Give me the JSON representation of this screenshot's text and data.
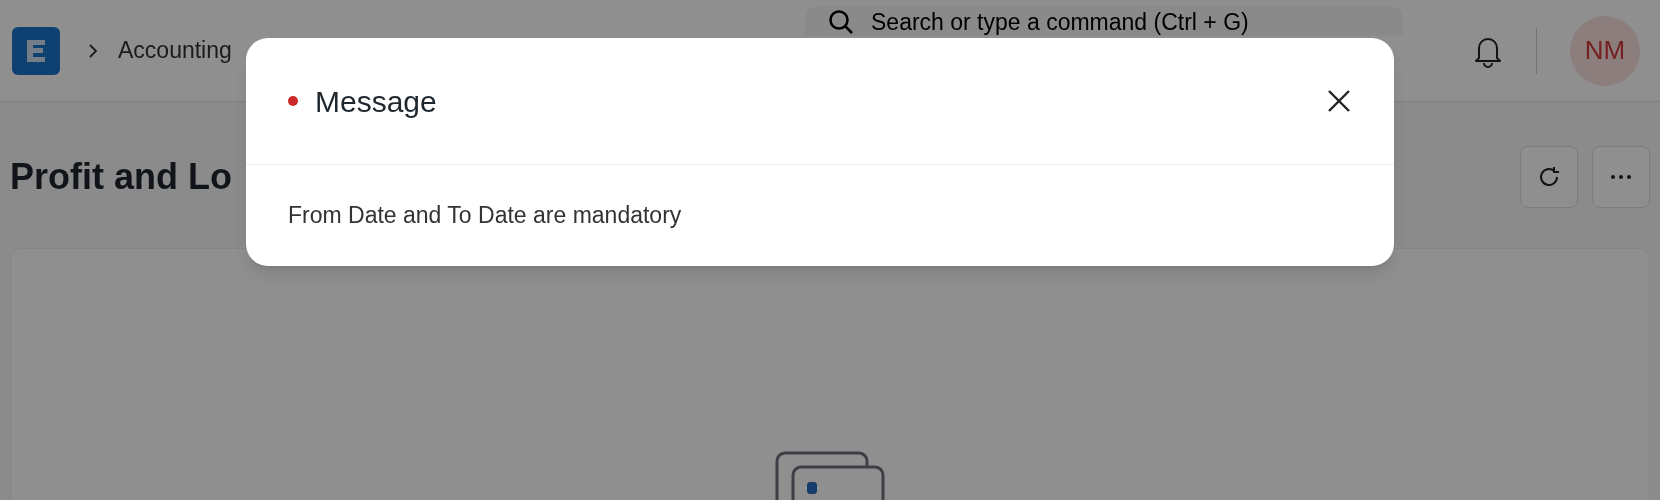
{
  "header": {
    "breadcrumbs": [
      "Accounting"
    ],
    "search": {
      "placeholder": "Search or type a command (Ctrl + G)"
    },
    "avatar": {
      "initials": "NM"
    }
  },
  "page": {
    "title": "Profit and Lo"
  },
  "dialog": {
    "title": "Message",
    "message": "From Date and To Date are mandatory"
  }
}
